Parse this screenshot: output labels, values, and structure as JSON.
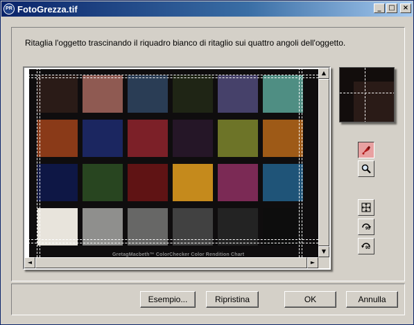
{
  "window": {
    "title": "FotoGrezza.tif",
    "app_icon_text": "PR",
    "minimize_glyph": "_",
    "maximize_glyph": "□",
    "close_glyph": "×"
  },
  "instruction": "Ritaglia l'oggetto trascinando il riquadro bianco di ritaglio sui quattro angoli dell'oggetto.",
  "image": {
    "caption": "GretagMacbeth™ ColorChecker Color Rendition Chart",
    "patches": [
      [
        "#2a1b17",
        "#8f5a52",
        "#2a3d55",
        "#1f2515",
        "#46416a",
        "#4f8e83"
      ],
      [
        "#8a3a18",
        "#1b2660",
        "#7c2028",
        "#251627",
        "#6d7428",
        "#9e5a17"
      ],
      [
        "#0e1745",
        "#284520",
        "#5f1314",
        "#c58a1c",
        "#7b2a55",
        "#1f5478"
      ],
      [
        "#e8e4dc",
        "#8f8f8d",
        "#676766",
        "#414141",
        "#232323",
        "#0d0d0d"
      ]
    ]
  },
  "scrollbar": {
    "up_glyph": "▲",
    "down_glyph": "▼",
    "left_glyph": "◄",
    "right_glyph": "►"
  },
  "tools": {
    "crop_icon": "crop-brush-icon",
    "zoom_icon": "magnifier-icon",
    "fit_icon": "fit-to-window-icon",
    "rotate_cw_label": "90",
    "rotate_ccw_label": "90"
  },
  "buttons": {
    "example": "Esempio...",
    "reset": "Ripristina",
    "ok": "OK",
    "cancel": "Annulla"
  },
  "colors": {
    "titlebar_start": "#0a246a",
    "dialog_bg": "#d4d0c8",
    "crop_active_bg": "#e8a1a1"
  }
}
